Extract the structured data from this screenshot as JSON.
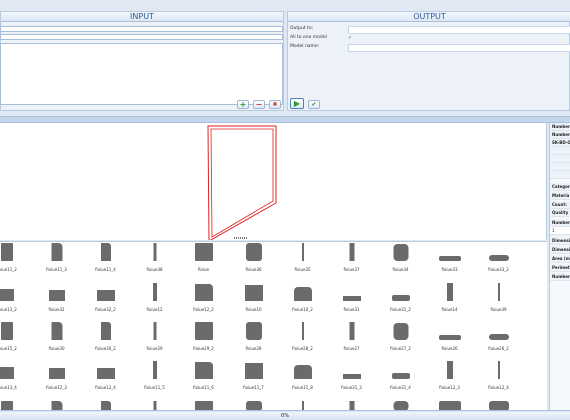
{
  "input": {
    "title": "INPUT",
    "buttons": {
      "add": "+",
      "remove": "−",
      "clear": "✖"
    }
  },
  "output": {
    "title": "OUTPUT",
    "fields": [
      {
        "label": "Output to:",
        "value": ""
      },
      {
        "label": "All to one model",
        "value": "✓"
      },
      {
        "label": "Model name:",
        "value": ""
      }
    ],
    "buttons": {
      "run": "▶",
      "confirm": "✔"
    }
  },
  "right_panel": {
    "rows": [
      "Number",
      "Number",
      "SK-BD-O",
      "",
      "",
      "",
      "",
      "Categor",
      "Materia",
      "Count:",
      "Quality",
      "Number",
      "1",
      "",
      "Dimensi",
      "Dimensi",
      "Area (m",
      "Perimet",
      "Number"
    ]
  },
  "parts": [
    [
      "fixiue11_2",
      "fixiue11_3",
      "fixiue11_4",
      "fixiue38",
      "fixiue",
      "fixiue36",
      "fixiue35",
      "fixiue37",
      "fixiue34",
      "fixiue33",
      "fixiue33_2"
    ],
    [
      "fixiue13_2",
      "fixiue32",
      "fixiue32_2",
      "fixiue12",
      "fixiue12_2",
      "fixiue10",
      "fixiue10_2",
      "fixiue31",
      "fixiue31_2",
      "fixiue14",
      "fixiue39"
    ],
    [
      "fixiue15_2",
      "fixiue30",
      "fixiue30_2",
      "fixiue29",
      "fixiue29_2",
      "fixiue28",
      "fixiue28_2",
      "fixiue27",
      "fixiue27_2",
      "fixiue26",
      "fixiue26_2"
    ],
    [
      "fixiue13_4",
      "fixiue12_3",
      "fixiue12_4",
      "fixiue11_5",
      "fixiue11_6",
      "fixiue11_7",
      "fixiue11_8",
      "fixiue31_3",
      "fixiue31_4",
      "fixiue12_3",
      "fixiue12_4"
    ],
    [
      "",
      "",
      "",
      "",
      "",
      "",
      "",
      "",
      "",
      "",
      ""
    ]
  ],
  "status": {
    "progress_text": "0%",
    "progress": 0
  }
}
